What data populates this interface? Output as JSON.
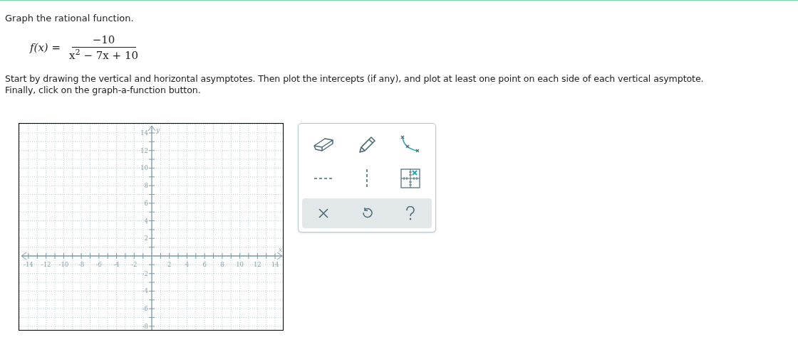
{
  "instruction": "Graph the rational function.",
  "formula": {
    "lhs": "f(x) =",
    "numerator": "−10",
    "denominator": "x$^{2}$ − 7x + 10"
  },
  "directions": [
    "Start by drawing the vertical and horizontal asymptotes. Then plot the intercepts (if any), and plot at least one point on each side of each vertical asymptote.",
    "Finally, click on the graph-a-function button."
  ],
  "graph": {
    "x_axis_label": "x",
    "y_axis_label": "y",
    "x_ticks": [
      "-14",
      "-12",
      "-10",
      "-8",
      "-6",
      "-4",
      "-2",
      "2",
      "4",
      "6",
      "8",
      "10",
      "12",
      "14"
    ],
    "y_ticks": [
      "14",
      "12",
      "10",
      "8",
      "6",
      "4",
      "2",
      "-2",
      "-4",
      "-6",
      "-8"
    ]
  },
  "tools": [
    {
      "kind": "eraser"
    },
    {
      "kind": "pencil"
    },
    {
      "kind": "curve"
    },
    {
      "kind": "horizontal-asymptote"
    },
    {
      "kind": "vertical-asymptote"
    },
    {
      "kind": "point"
    }
  ],
  "actions": [
    {
      "kind": "clear"
    },
    {
      "kind": "undo"
    },
    {
      "kind": "help"
    }
  ]
}
